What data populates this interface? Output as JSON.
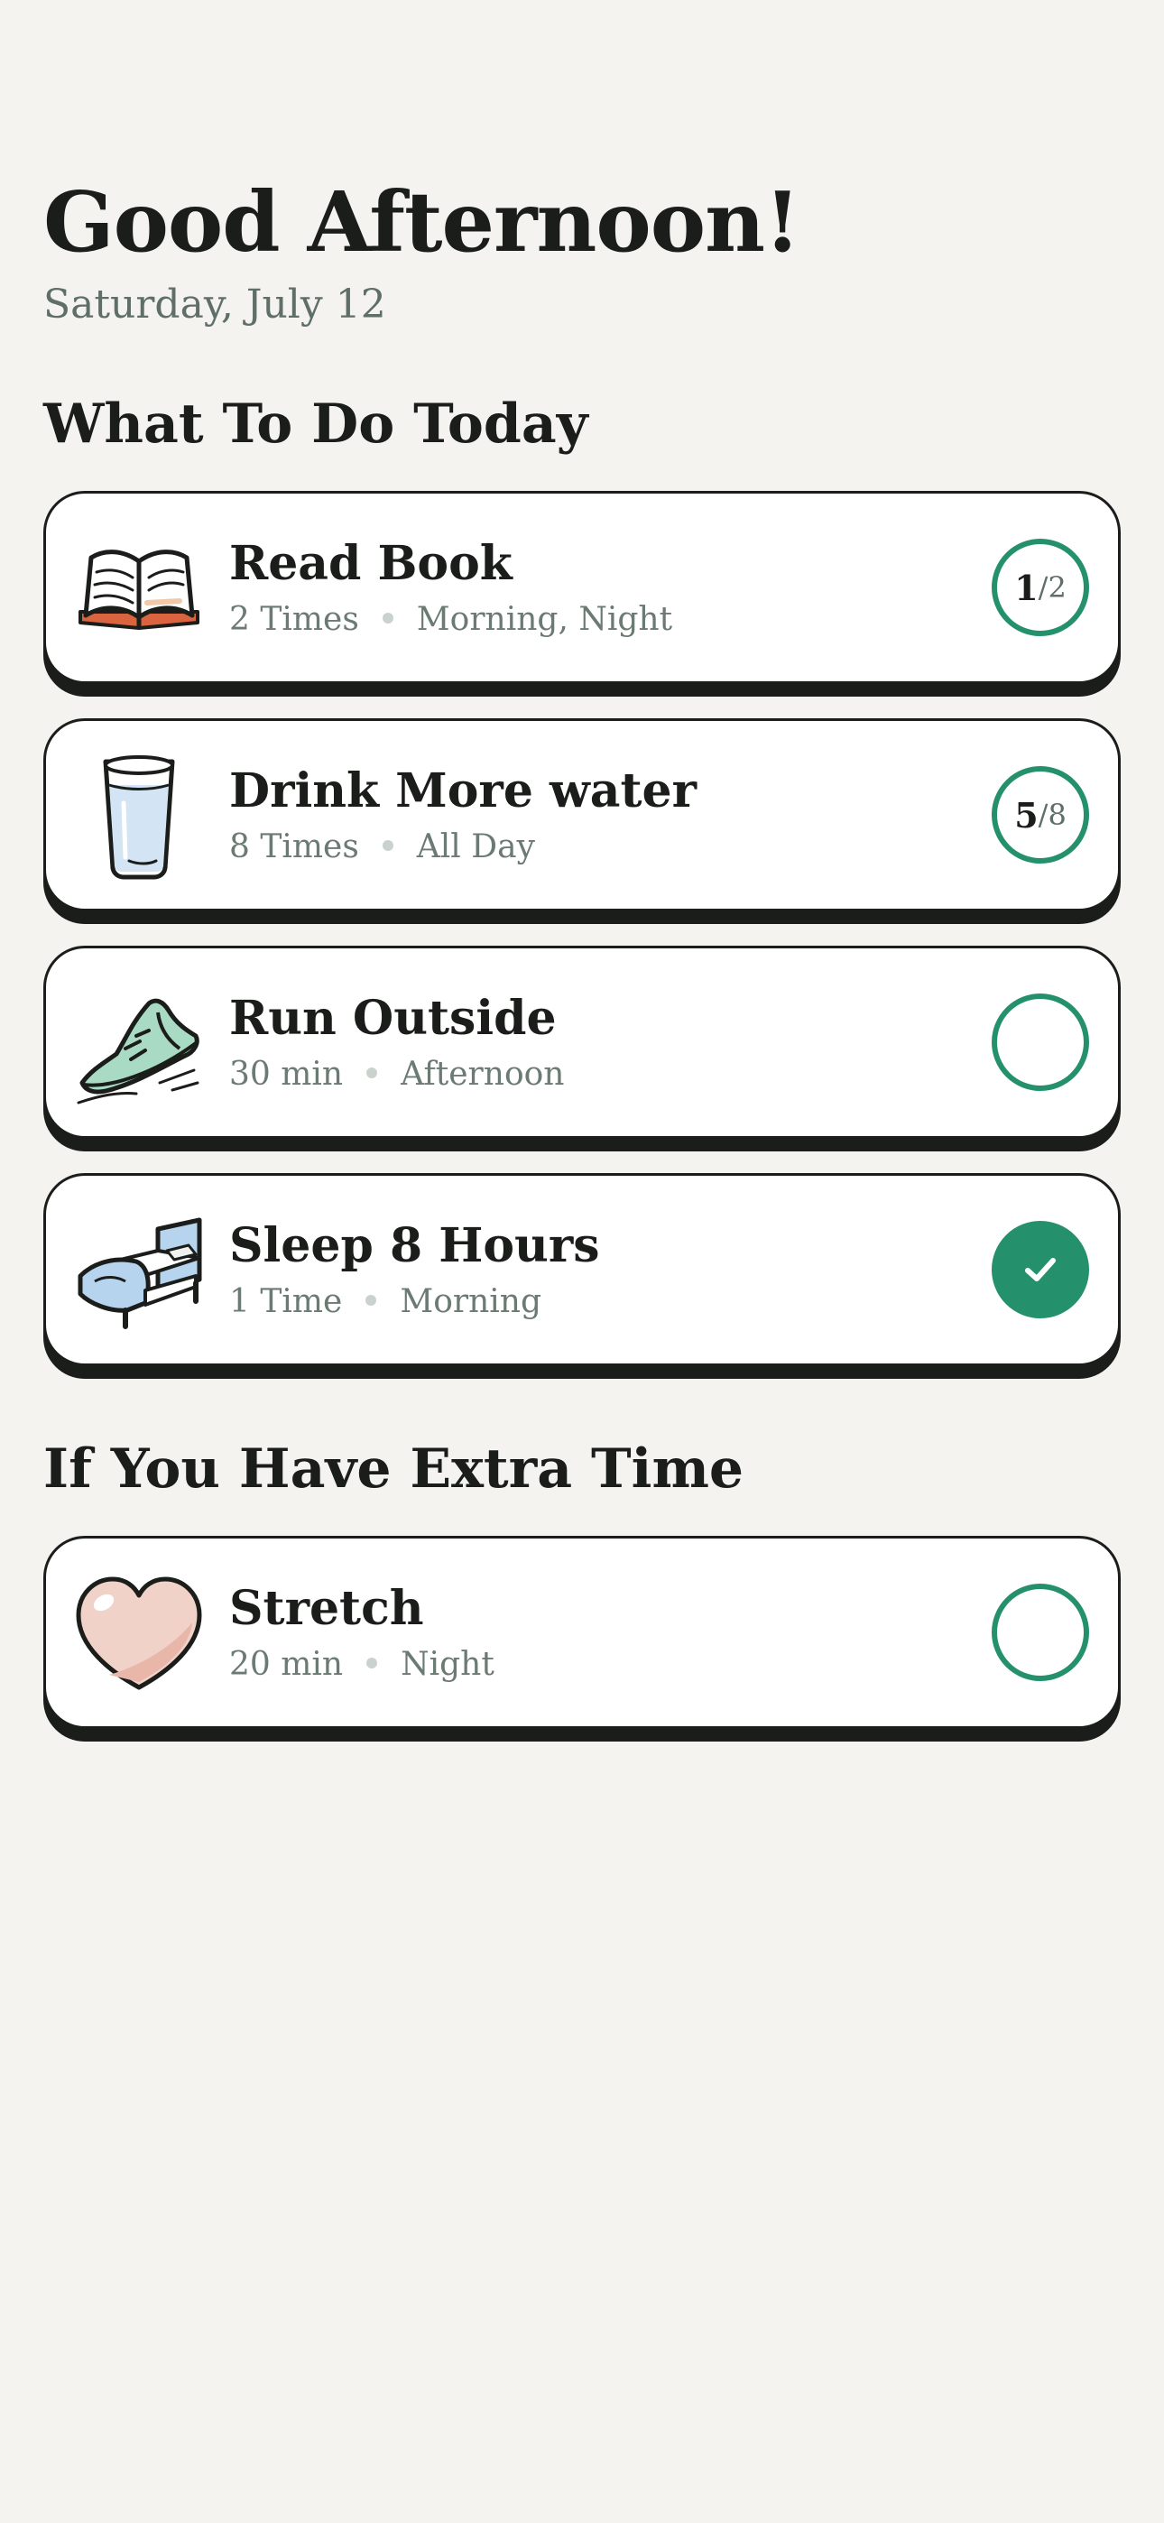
{
  "header": {
    "greeting": "Good Afternoon!",
    "date": "Saturday, July 12"
  },
  "sections": [
    {
      "title": "What To Do Today",
      "items": [
        {
          "title": "Read Book",
          "frequency": "2 Times",
          "time": "Morning, Night",
          "done": 1,
          "total_label": "/2",
          "total": 2,
          "icon": "open-book-icon"
        },
        {
          "title": "Drink More water",
          "frequency": "8 Times",
          "time": "All Day",
          "done": 5,
          "total_label": "/8",
          "total": 8,
          "icon": "water-glass-icon"
        },
        {
          "title": "Run Outside",
          "frequency": "30 min",
          "time": "Afternoon",
          "state": "not-started",
          "icon": "running-shoe-icon"
        },
        {
          "title": "Sleep 8 Hours",
          "frequency": "1 Time",
          "time": "Morning",
          "state": "completed",
          "icon": "bed-icon"
        }
      ]
    },
    {
      "title": "If You Have Extra Time",
      "items": [
        {
          "title": "Stretch",
          "frequency": "20 min",
          "time": "Night",
          "state": "not-started",
          "icon": "heart-icon"
        }
      ]
    }
  ],
  "colors": {
    "accent": "#24916c",
    "background": "#f4f3f0",
    "text": "#1b1d1b",
    "muted": "#6b7a73"
  }
}
